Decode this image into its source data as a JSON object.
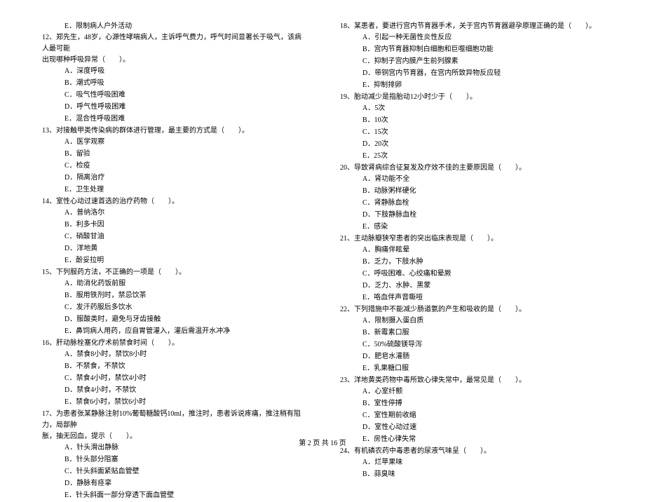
{
  "left": {
    "q11_e": "E．限制病人户外活动",
    "q12_stem1": "12、郑先生，48岁，心源性哮喘病人，主诉呼气费力，呼气时间显著长于吸气，该病人最可能",
    "q12_stem2": "出现哪种呼吸异常（　　）。",
    "q12_a": "A．深度呼吸",
    "q12_b": "B．潮式呼吸",
    "q12_c": "C．吸气性呼吸困难",
    "q12_d": "D．呼气性呼吸困难",
    "q12_e": "E．混合性呼吸困难",
    "q13_stem": "13、对接触甲类传染病的群体进行管理，最主要的方式是（　　）。",
    "q13_a": "A．医学观察",
    "q13_b": "B．留验",
    "q13_c": "C．检疫",
    "q13_d": "D．隔离治疗",
    "q13_e": "E．卫生处理",
    "q14_stem": "14、室性心动过速首选的治疗药物（　　）。",
    "q14_a": "A．普纳洛尔",
    "q14_b": "B．利多卡因",
    "q14_c": "C．硝酸甘油",
    "q14_d": "D．洋地黄",
    "q14_e": "E．酚妥拉明",
    "q15_stem": "15、下列服药方法，不正确的一项是（　　）。",
    "q15_a": "A．助消化药饭前服",
    "q15_b": "B．服用铁剂时，禁忌饮茶",
    "q15_c": "C．发汗药服后多饮水",
    "q15_d": "D．服酸类时，避免与牙齿接触",
    "q15_e": "E．鼻饲病人用药，应自胃管灌入，灌后需温开水冲净",
    "q16_stem": "16、肝动脉栓塞化疗术前禁食时间（　　）。",
    "q16_a": "A．禁食8小时，禁饮8小时",
    "q16_b": "B．不禁食，不禁饮",
    "q16_c": "C．禁食4小时，禁饮4小时",
    "q16_d": "D．禁食4小时，不禁饮",
    "q16_e": "E．禁食6小时，禁饮6小时",
    "q17_stem1": "17、为患者张某静脉注射10%葡萄糖酸钙10ml，推注时，患者诉说疼痛，推注稍有阻力，局部肿",
    "q17_stem2": "胀，抽无回血，提示（　　）。",
    "q17_a": "A．针头滑出静脉",
    "q17_b": "B．针头部分阻塞",
    "q17_c": "C．针头斜面紧贴血管壁",
    "q17_d": "D．静脉有痉挛",
    "q17_e": "E．针头斜面一部分穿透下面血管壁"
  },
  "right": {
    "q18_stem": "18、某患者，要进行宫内节育器手术，关于宫内节育器避孕原理正确的是（　　）。",
    "q18_a": "A．引起一种无菌性炎性反应",
    "q18_b": "B．宫内节育器抑制白细胞和巨噬细胞功能",
    "q18_c": "C．抑制子宫内膜产生前列腺素",
    "q18_d": "D．带铜宫内节育器，在宫内所致异物反应轻",
    "q18_e": "E．抑制排卵",
    "q19_stem": "19、胎动减少是指胎动12小时少于（　　）。",
    "q19_a": "A．5次",
    "q19_b": "B．10次",
    "q19_c": "C．15次",
    "q19_d": "D．20次",
    "q19_e": "E．25次",
    "q20_stem": "20、导致肾病综合征复发及疗效不佳的主要原因是（　　）。",
    "q20_a": "A．肾功能不全",
    "q20_b": "B．动脉粥样硬化",
    "q20_c": "C．肾静脉血栓",
    "q20_d": "D．下肢静脉血栓",
    "q20_e": "E．感染",
    "q21_stem": "21、主动脉瓣狭窄患者的突出临床表现是（　　）。",
    "q21_a": "A．胸痛伴眩晕",
    "q21_b": "B．乏力，下肢水肿",
    "q21_c": "C．呼吸困难、心绞痛和晕厥",
    "q21_d": "D．乏力、水肿、黑蒙",
    "q21_e": "E．咯血伴声音嘶哑",
    "q22_stem": "22、下列措施中不能减少肠道氨的产生和吸收的是（　　）。",
    "q22_a": "A．限制摄入蛋白质",
    "q22_b": "B．新霉素口服",
    "q22_c": "C．50%硫酸镁导泻",
    "q22_d": "D．肥皂水灌肠",
    "q22_e": "E．乳果糖口服",
    "q23_stem": "23、洋地黄类药物中毒所致心律失常中，最常见是（　　）。",
    "q23_a": "A．心室纤颤",
    "q23_b": "B．室性停搏",
    "q23_c": "C．室性期前收缩",
    "q23_d": "D．室性心动过速",
    "q23_e": "E．房性心律失常",
    "q24_stem": "24、有机磷农药中毒患者的尿液气味呈（　　）。",
    "q24_a": "A．烂苹果味",
    "q24_b": "B．蒜臭味"
  },
  "footer": "第 2 页 共 16 页"
}
